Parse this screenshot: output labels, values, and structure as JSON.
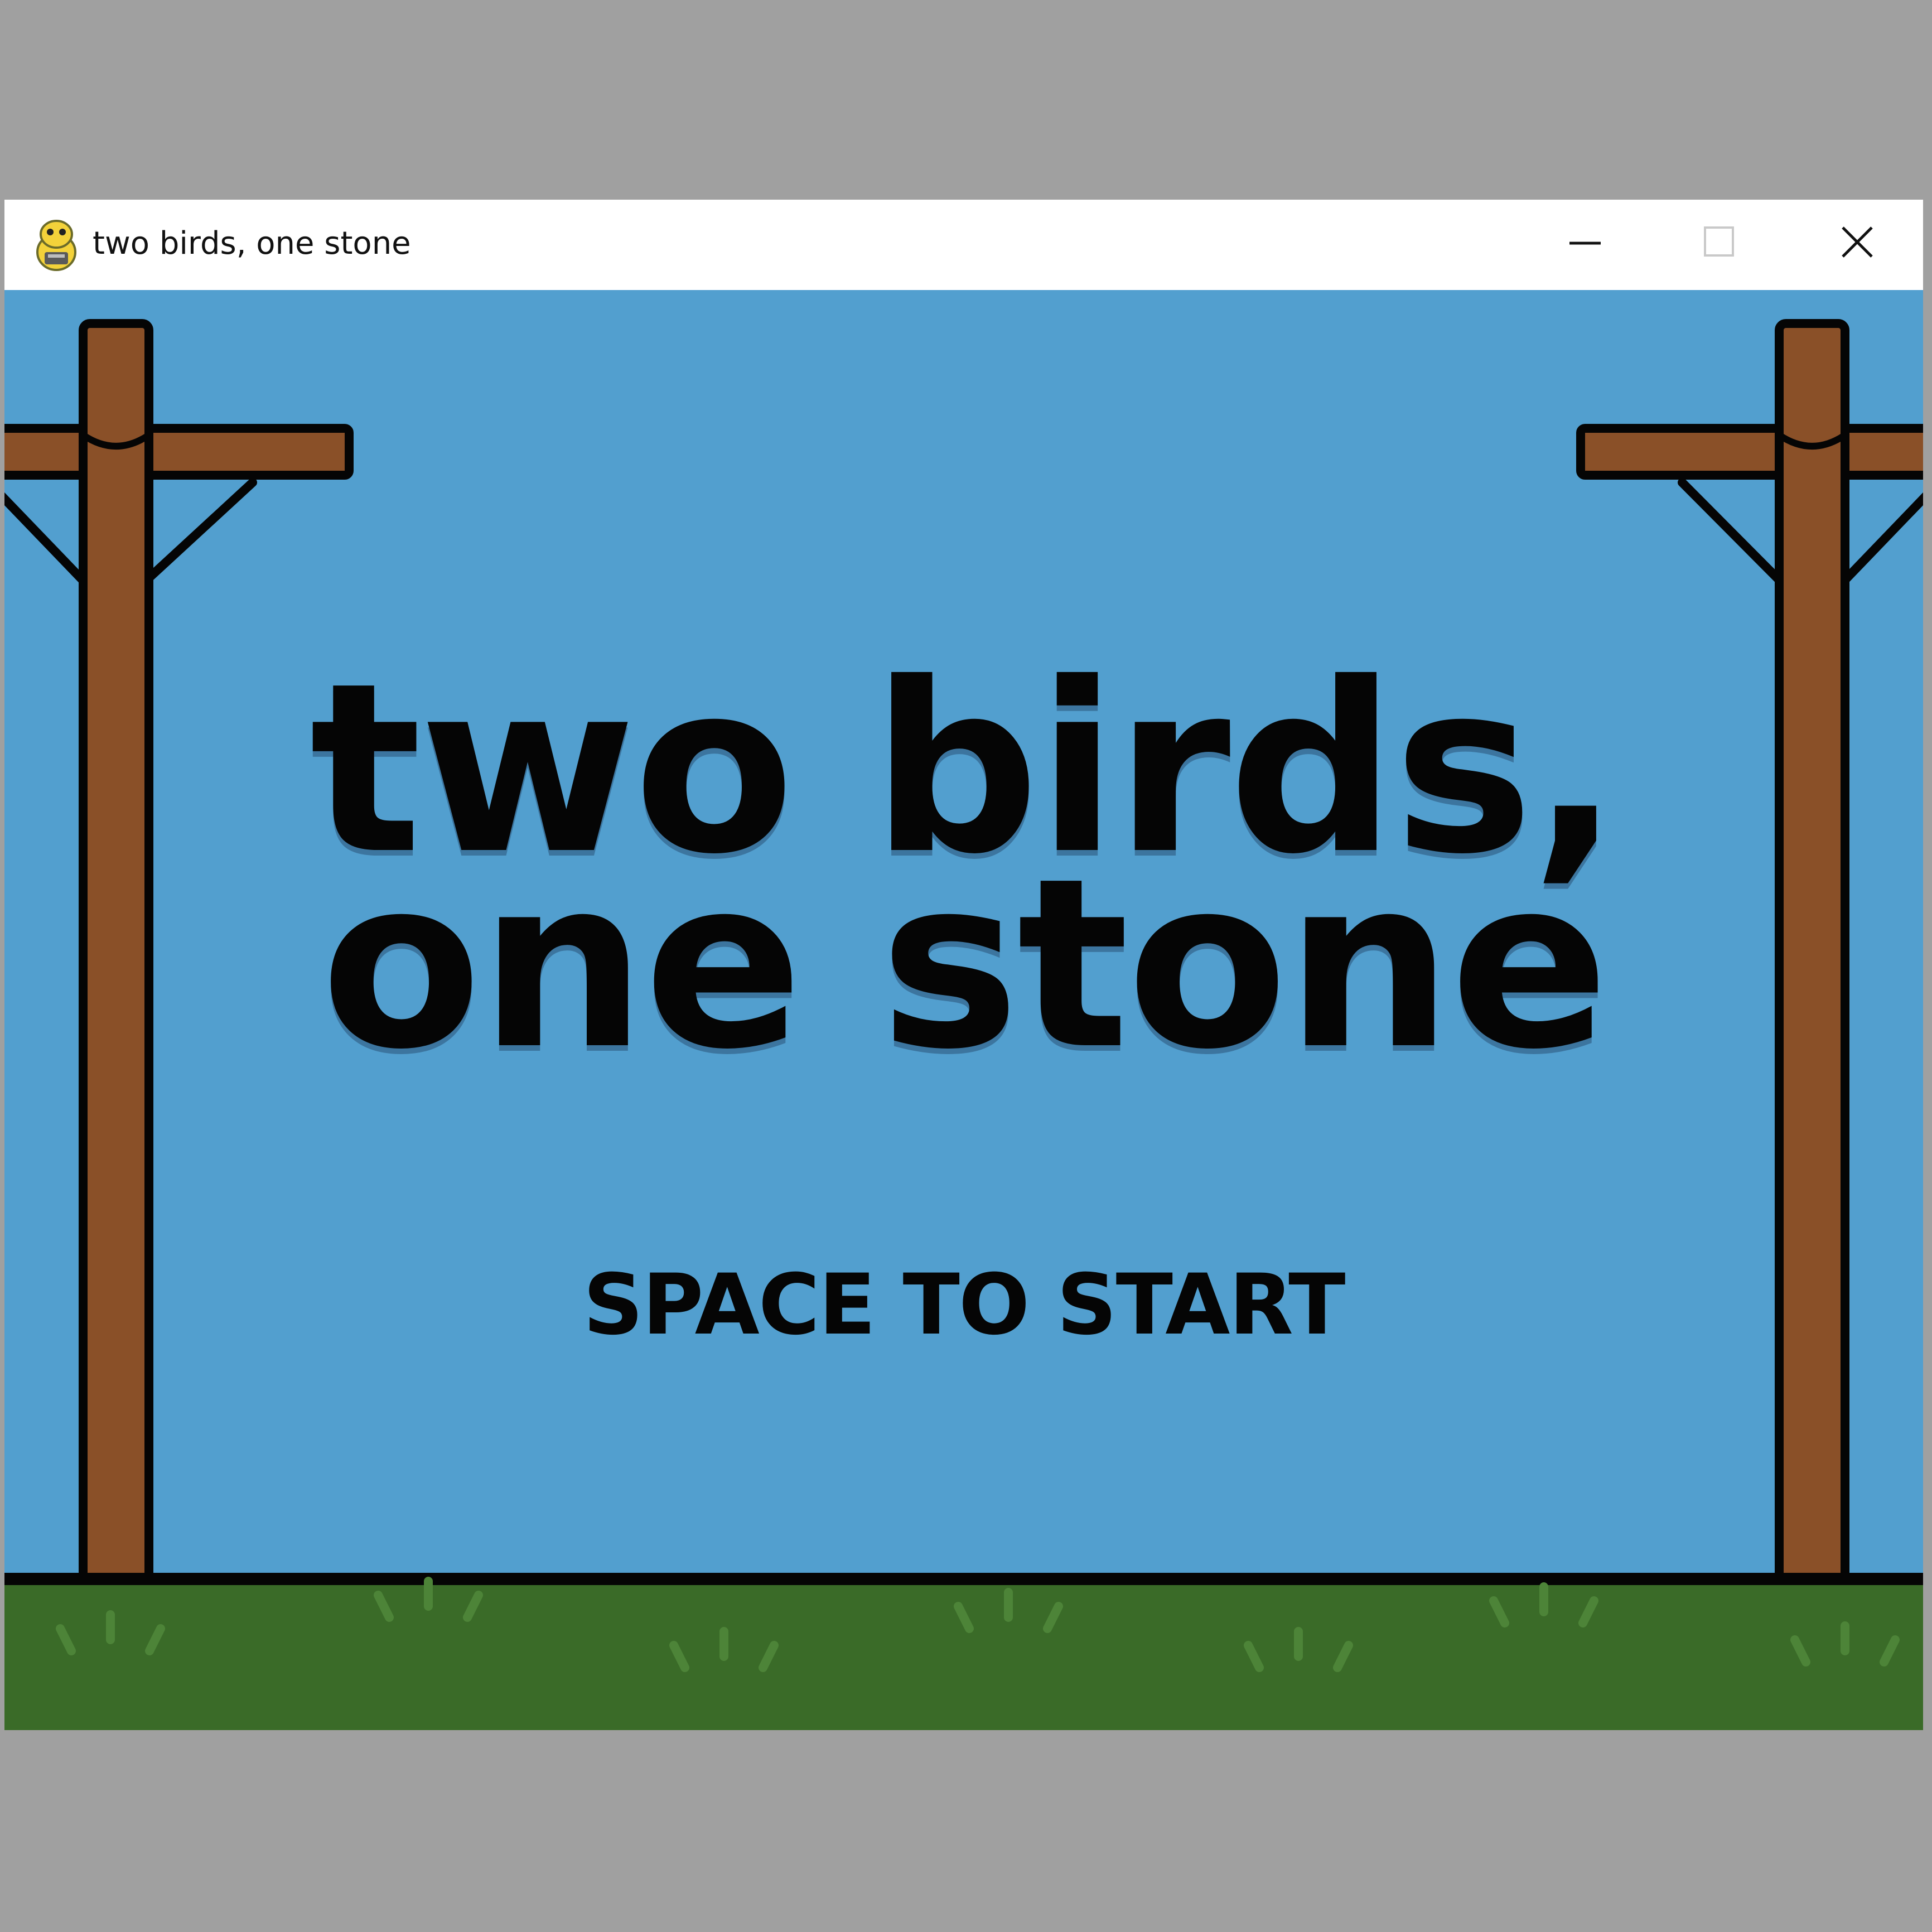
{
  "window": {
    "title": "two birds, one stone",
    "app_icon": "pygame-snake-icon",
    "controls": {
      "minimize_icon": "minimize-icon",
      "maximize_icon": "maximize-icon",
      "close_icon": "close-icon"
    }
  },
  "game": {
    "title_line_1": "two birds,",
    "title_line_2": "one stone",
    "start_prompt": "SPACE TO START"
  },
  "colors": {
    "sky": "#529fcf",
    "grass": "#3a6b28",
    "grass_tuft": "#4d8438",
    "pole": "#8a5028",
    "outline": "#050505",
    "page_background": "#a0a0a0"
  }
}
